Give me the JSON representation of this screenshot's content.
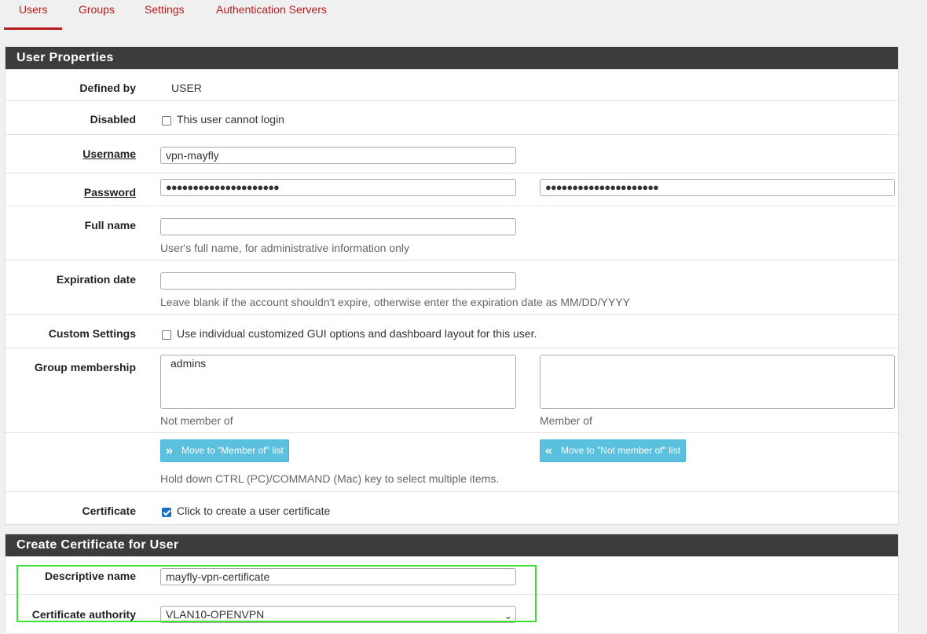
{
  "tabs": [
    {
      "label": "Users",
      "active": true
    },
    {
      "label": "Groups",
      "active": false
    },
    {
      "label": "Settings",
      "active": false
    },
    {
      "label": "Authentication Servers",
      "active": false
    }
  ],
  "user_properties": {
    "title": "User Properties",
    "defined_by": {
      "label": "Defined by",
      "value": "USER"
    },
    "disabled": {
      "label": "Disabled",
      "checkbox_label": "This user cannot login",
      "checked": false
    },
    "username": {
      "label": "Username",
      "value": "vpn-mayfly"
    },
    "password": {
      "label": "Password",
      "value": "●●●●●●●●●●●●●●●●●●●●●",
      "confirm": "●●●●●●●●●●●●●●●●●●●●●"
    },
    "full_name": {
      "label": "Full name",
      "value": "",
      "help": "User's full name, for administrative information only"
    },
    "expiration": {
      "label": "Expiration date",
      "value": "",
      "help": "Leave blank if the account shouldn't expire, otherwise enter the expiration date as MM/DD/YYYY"
    },
    "custom_settings": {
      "label": "Custom Settings",
      "checkbox_label": "Use individual customized GUI options and dashboard layout for this user.",
      "checked": false
    },
    "group_membership": {
      "label": "Group membership",
      "not_member_items": [
        "admins"
      ],
      "member_items": [],
      "not_member_caption": "Not member of",
      "member_caption": "Member of",
      "move_to_member_label": "Move to \"Member of\" list",
      "move_to_not_member_label": "Move to \"Not member of\" list",
      "help": "Hold down CTRL (PC)/COMMAND (Mac) key to select multiple items."
    },
    "certificate": {
      "label": "Certificate",
      "checkbox_label": "Click to create a user certificate",
      "checked": true
    }
  },
  "create_cert": {
    "title": "Create Certificate for User",
    "descriptive_name": {
      "label": "Descriptive name",
      "value": "mayfly-vpn-certificate"
    },
    "certificate_authority": {
      "label": "Certificate authority",
      "value": "VLAN10-OPENVPN"
    }
  },
  "colors": {
    "accent": "#b71c1c",
    "panel_header": "#3c3c3c",
    "info_button": "#5bc0de",
    "highlight": "#3be03b"
  },
  "icons": {
    "move_right": "double-chevron-right-icon",
    "move_left": "double-chevron-left-icon",
    "select": "chevron-down-icon"
  }
}
